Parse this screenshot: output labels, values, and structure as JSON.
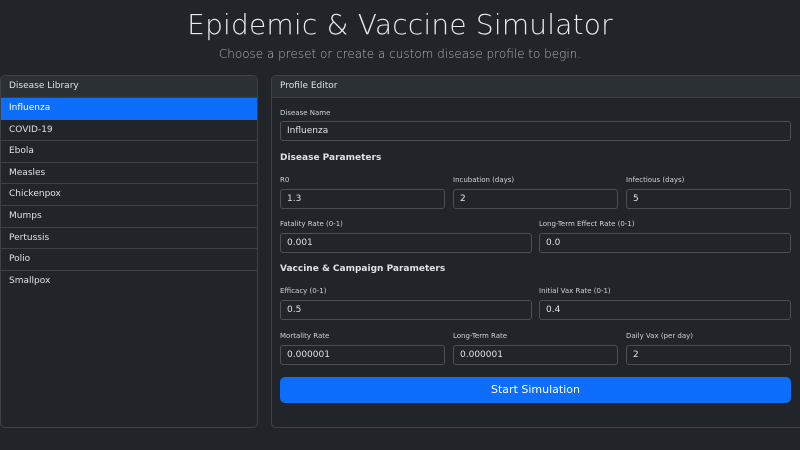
{
  "header": {
    "title": "Epidemic & Vaccine Simulator",
    "subtitle": "Choose a preset or create a custom disease profile to begin."
  },
  "library": {
    "title": "Disease Library",
    "items": [
      {
        "label": "Influenza",
        "active": true
      },
      {
        "label": "COVID-19",
        "active": false
      },
      {
        "label": "Ebola",
        "active": false
      },
      {
        "label": "Measles",
        "active": false
      },
      {
        "label": "Chickenpox",
        "active": false
      },
      {
        "label": "Mumps",
        "active": false
      },
      {
        "label": "Pertussis",
        "active": false
      },
      {
        "label": "Polio",
        "active": false
      },
      {
        "label": "Smallpox",
        "active": false
      }
    ]
  },
  "editor": {
    "title": "Profile Editor",
    "disease_name": {
      "label": "Disease Name",
      "value": "Influenza"
    },
    "disease_section": "Disease Parameters",
    "r0": {
      "label": "R0",
      "value": "1.3"
    },
    "incubation": {
      "label": "Incubation (days)",
      "value": "2"
    },
    "infectious": {
      "label": "Infectious (days)",
      "value": "5"
    },
    "fatality": {
      "label": "Fatality Rate (0-1)",
      "value": "0.001"
    },
    "long_term_effect": {
      "label": "Long-Term Effect Rate (0-1)",
      "value": "0.0"
    },
    "vaccine_section": "Vaccine & Campaign Parameters",
    "efficacy": {
      "label": "Efficacy (0-1)",
      "value": "0.5"
    },
    "initial_vax": {
      "label": "Initial Vax Rate (0-1)",
      "value": "0.4"
    },
    "mortality": {
      "label": "Mortality Rate",
      "value": "0.000001"
    },
    "long_term_rate": {
      "label": "Long-Term Rate",
      "value": "0.000001"
    },
    "daily_vax": {
      "label": "Daily Vax (per day)",
      "value": "2"
    },
    "start_label": "Start Simulation"
  },
  "colors": {
    "background": "#212529",
    "accent": "#0d6efd",
    "border": "#3b4148"
  }
}
